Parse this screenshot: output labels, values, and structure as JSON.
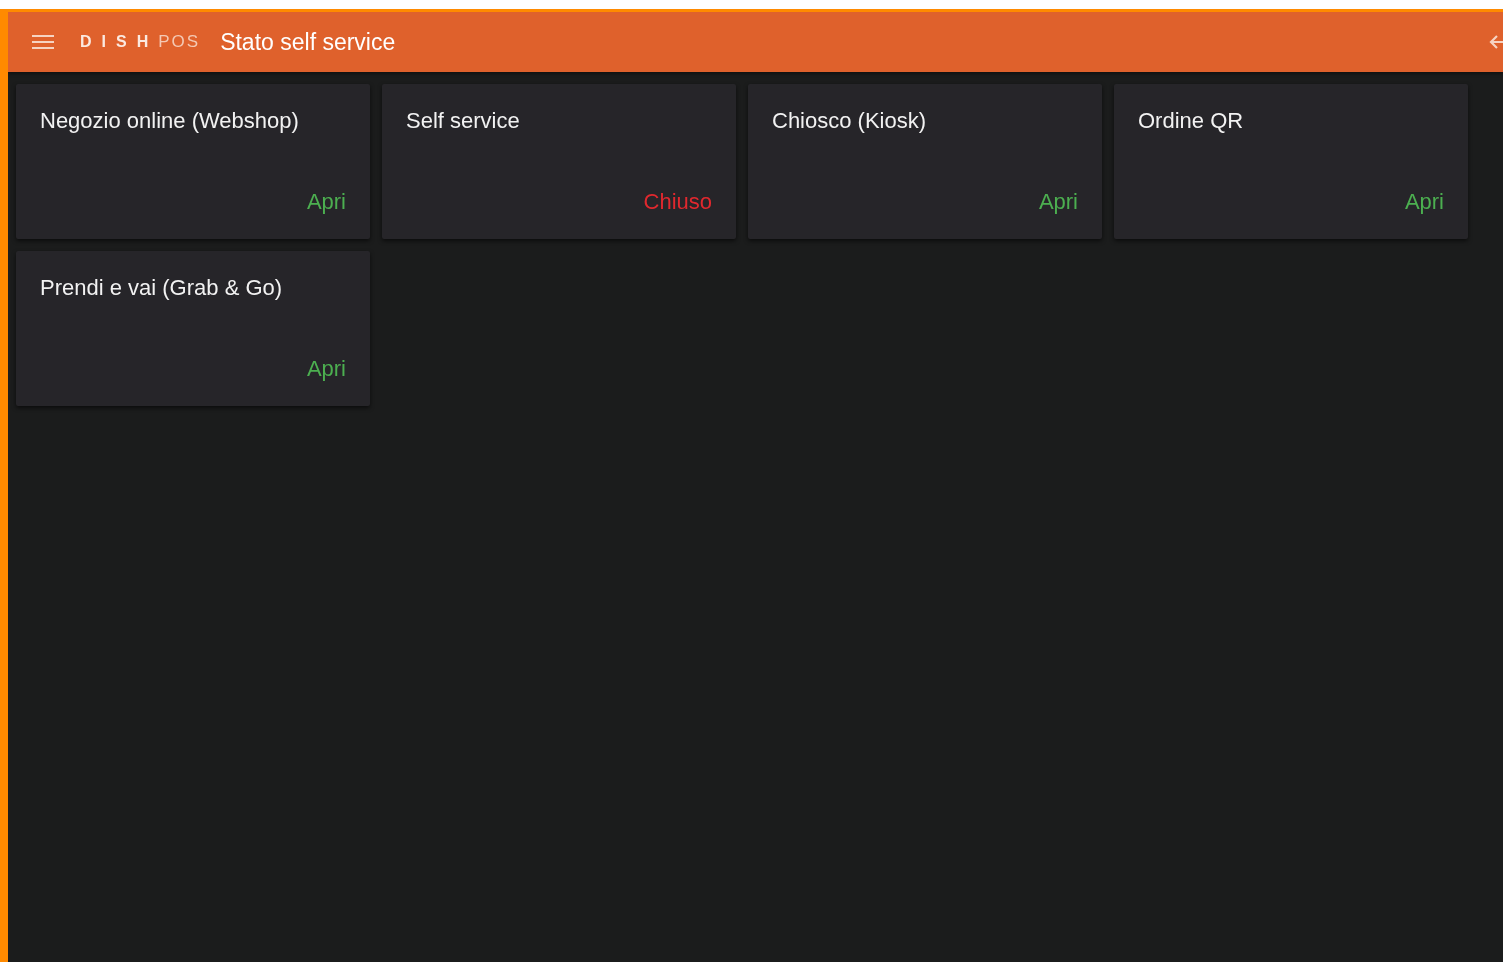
{
  "header": {
    "logo_brand": "DISH",
    "logo_product": "POS",
    "title": "Stato self service"
  },
  "channels": [
    {
      "name": "Negozio online (Webshop)",
      "open": true,
      "status": "Apri"
    },
    {
      "name": "Self service",
      "open": false,
      "status": "Chiuso"
    },
    {
      "name": "Chiosco (Kiosk)",
      "open": true,
      "status": "Apri"
    },
    {
      "name": "Ordine QR",
      "open": true,
      "status": "Apri"
    },
    {
      "name": "Prendi e vai (Grab & Go)",
      "open": true,
      "status": "Apri"
    }
  ]
}
